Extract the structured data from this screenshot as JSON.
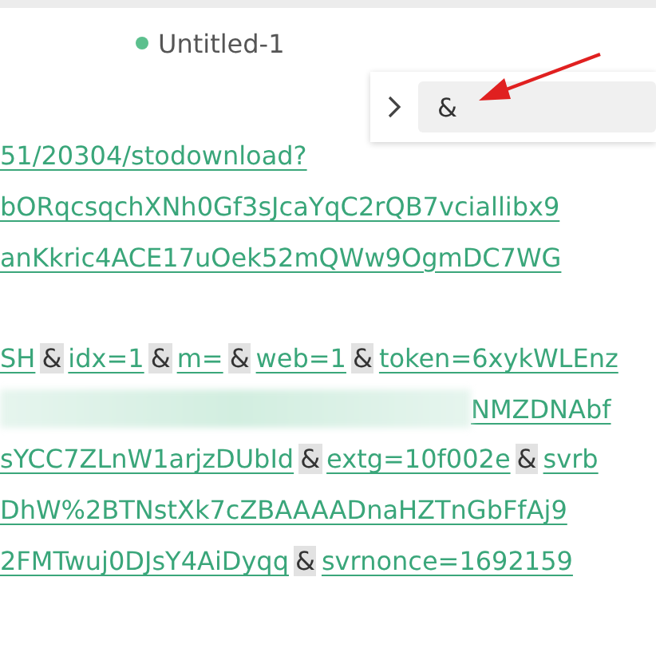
{
  "tab": {
    "title": "Untitled-1",
    "modified": true
  },
  "find_widget": {
    "expanded": false,
    "value": "&"
  },
  "lines": [
    {
      "kind": "text",
      "segments": [
        {
          "kind": "link",
          "text": "51/20304/stodownload?"
        }
      ]
    },
    {
      "kind": "text",
      "segments": [
        {
          "kind": "link",
          "text": "bORqcsqchXNh0Gf3sJcaYqC2rQB7vciallibx9"
        }
      ]
    },
    {
      "kind": "text",
      "segments": [
        {
          "kind": "link",
          "text": "anKkric4ACE17uOek52mQWw9OgmDC7WG"
        }
      ]
    },
    {
      "kind": "blank"
    },
    {
      "kind": "text",
      "segments": [
        {
          "kind": "link",
          "text": "SH"
        },
        {
          "kind": "match",
          "text": "&"
        },
        {
          "kind": "link",
          "text": "idx=1"
        },
        {
          "kind": "match",
          "text": "&"
        },
        {
          "kind": "link",
          "text": "m="
        },
        {
          "kind": "match",
          "text": "&"
        },
        {
          "kind": "link",
          "text": "web=1"
        },
        {
          "kind": "match",
          "text": "&"
        },
        {
          "kind": "link",
          "text": "token=6xykWLEnz"
        }
      ]
    },
    {
      "kind": "text",
      "segments": [
        {
          "kind": "blurred"
        },
        {
          "kind": "link",
          "text": "NMZDNAbf"
        }
      ]
    },
    {
      "kind": "text",
      "segments": [
        {
          "kind": "link",
          "text": "sYCC7ZLnW1arjzDUbId"
        },
        {
          "kind": "match",
          "text": "&"
        },
        {
          "kind": "link",
          "text": "extg=10f002e"
        },
        {
          "kind": "match",
          "text": "&"
        },
        {
          "kind": "link",
          "text": "svrb"
        }
      ]
    },
    {
      "kind": "text",
      "segments": [
        {
          "kind": "link",
          "text": "DhW%2BTNstXk7cZBAAAADnaHZTnGbFfAj9"
        }
      ]
    },
    {
      "kind": "text",
      "segments": [
        {
          "kind": "link",
          "text": "2FMTwuj0DJsY4AiDyqq"
        },
        {
          "kind": "match",
          "text": "&"
        },
        {
          "kind": "link",
          "text": "svrnonce=1692159"
        }
      ]
    }
  ]
}
